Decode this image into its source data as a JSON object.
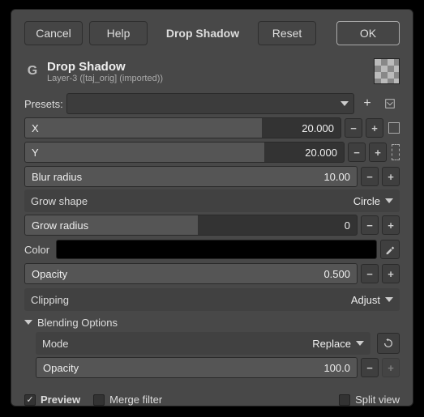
{
  "buttons": {
    "cancel": "Cancel",
    "help": "Help",
    "name": "Drop Shadow",
    "reset": "Reset",
    "ok": "OK"
  },
  "header": {
    "title": "Drop Shadow",
    "subtitle": "Layer-3 ([taj_orig] (imported))"
  },
  "presets_label": "Presets:",
  "icons": {
    "plus": "+",
    "minus": "−"
  },
  "fields": {
    "x": {
      "label": "X",
      "value": "20.000",
      "fill": 75
    },
    "y": {
      "label": "Y",
      "value": "20.000",
      "fill": 75
    },
    "blur": {
      "label": "Blur radius",
      "value": "10.00",
      "fill": 100
    },
    "grow_shape": {
      "label": "Grow shape",
      "value": "Circle"
    },
    "grow_radius": {
      "label": "Grow radius",
      "value": "0",
      "fill": 52
    },
    "color_label": "Color",
    "opacity": {
      "label": "Opacity",
      "value": "0.500",
      "fill": 100
    },
    "clipping": {
      "label": "Clipping",
      "value": "Adjust"
    }
  },
  "blending": {
    "header": "Blending Options",
    "mode": {
      "label": "Mode",
      "value": "Replace"
    },
    "opacity": {
      "label": "Opacity",
      "value": "100.0",
      "fill": 100
    }
  },
  "footer": {
    "preview": "Preview",
    "merge": "Merge filter",
    "split": "Split view",
    "preview_checked": true,
    "merge_checked": false,
    "split_checked": false
  }
}
